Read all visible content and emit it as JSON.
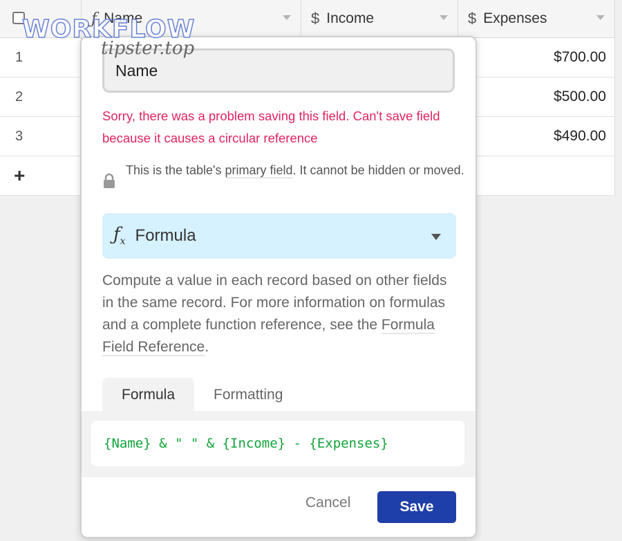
{
  "watermark": {
    "title": "WORKFLOW",
    "site": "tipster.top"
  },
  "grid": {
    "columns": [
      {
        "name": "Name",
        "icon": "formula-icon"
      },
      {
        "name": "Income",
        "icon": "currency-icon"
      },
      {
        "name": "Expenses",
        "icon": "currency-icon"
      }
    ],
    "rows": [
      {
        "num": "1",
        "expenses": "$700.00"
      },
      {
        "num": "2",
        "expenses": "$500.00"
      },
      {
        "num": "3",
        "expenses": "$490.00"
      }
    ],
    "add_row_label": "+"
  },
  "dialog": {
    "field_name": "Name",
    "error": "Sorry, there was a problem saving this field. Can't save field because it causes a circular reference",
    "primary_note_before": "This is the table's ",
    "primary_note_link": "primary field",
    "primary_note_after": ". It cannot be hidden or moved.",
    "type_label": "Formula",
    "description_before": "Compute a value in each record based on other fields in the same record. For more information on formulas and a complete function reference, see the ",
    "description_link": "Formula Field Reference",
    "description_after": ".",
    "tabs": [
      "Formula",
      "Formatting"
    ],
    "active_tab": "Formula",
    "formula": "{Name} & \" \" & {Income} - {Expenses}",
    "cancel_label": "Cancel",
    "save_label": "Save"
  },
  "colors": {
    "error": "#e0245e",
    "save_button": "#1f3fa8",
    "type_select_bg": "#d6f1ff",
    "formula_text": "#11a33a"
  }
}
